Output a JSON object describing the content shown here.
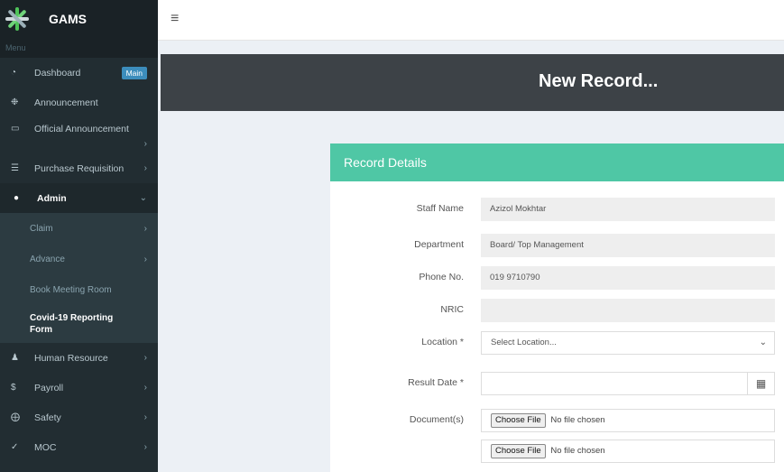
{
  "app": {
    "brand": "GAMS"
  },
  "sidebar": {
    "menu_header": "Menu",
    "items": [
      {
        "icon": "dashboard-icon",
        "label": "Dashboard",
        "badge": "Main"
      },
      {
        "icon": "bullhorn-icon",
        "label": "Announcement"
      },
      {
        "icon": "laptop-icon",
        "label": "Official Announcement"
      },
      {
        "icon": "cart-icon",
        "label": "Purchase Requisition"
      },
      {
        "icon": "users-icon",
        "label": "Admin"
      },
      {
        "icon": "user-icon",
        "label": "Human Resource"
      },
      {
        "icon": "dollar-icon",
        "label": "Payroll"
      },
      {
        "icon": "lifebuoy-icon",
        "label": "Safety"
      },
      {
        "icon": "check-icon",
        "label": "MOC"
      }
    ],
    "admin_sub": [
      {
        "label": "Claim"
      },
      {
        "label": "Advance"
      },
      {
        "label": "Book Meeting Room"
      },
      {
        "label": "Covid-19 Reporting Form"
      }
    ]
  },
  "page": {
    "title": "New Record..."
  },
  "card": {
    "header": "Record Details",
    "fields": {
      "staff_name": {
        "label": "Staff Name",
        "value": "Azizol Mokhtar"
      },
      "department": {
        "label": "Department",
        "value": "Board/ Top Management"
      },
      "phone": {
        "label": "Phone No.",
        "value": "019 9710790"
      },
      "nric": {
        "label": "NRIC",
        "value": ""
      },
      "location": {
        "label": "Location *",
        "value": "Select Location..."
      },
      "result_date": {
        "label": "Result Date *",
        "value": ""
      },
      "documents": {
        "label": "Document(s)",
        "button": "Choose File",
        "status": "No file chosen"
      }
    }
  }
}
